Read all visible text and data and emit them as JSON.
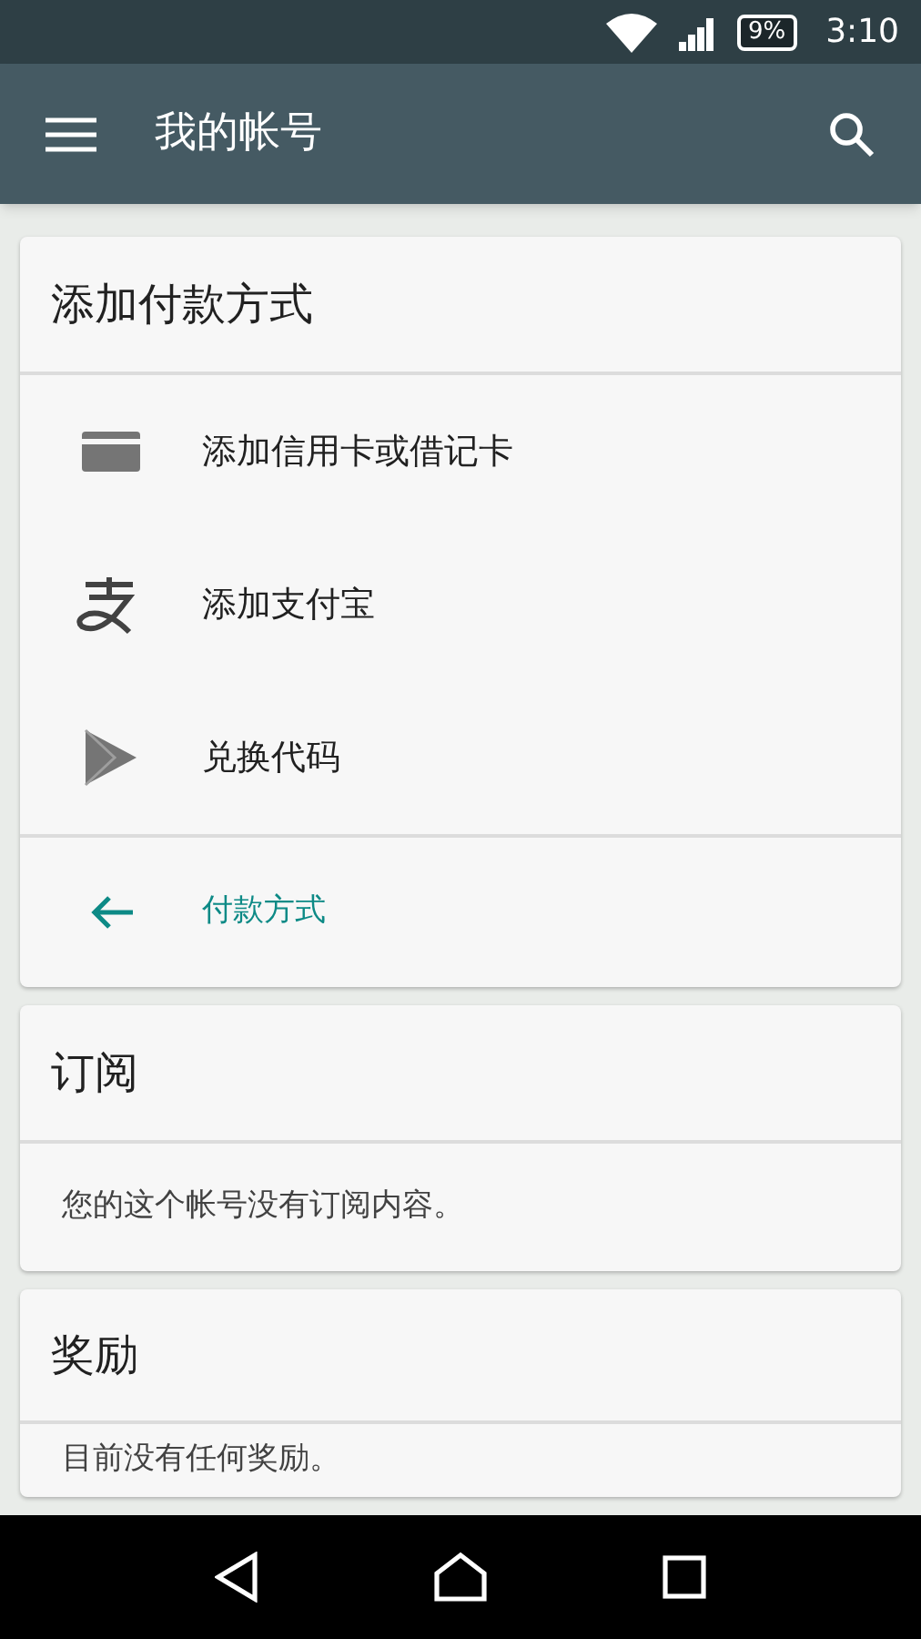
{
  "status_bar": {
    "battery": "9%",
    "time": "3:10"
  },
  "app_bar": {
    "title": "我的帐号"
  },
  "payment": {
    "title": "添加付款方式",
    "items": [
      {
        "kind": "card",
        "label": "添加信用卡或借记卡"
      },
      {
        "kind": "alipay",
        "label": "添加支付宝"
      },
      {
        "kind": "play",
        "label": "兑换代码"
      }
    ],
    "link": "付款方式"
  },
  "subscriptions": {
    "title": "订阅",
    "text": "您的这个帐号没有订阅内容。"
  },
  "rewards": {
    "title": "奖励",
    "text": "目前没有任何奖励。"
  }
}
